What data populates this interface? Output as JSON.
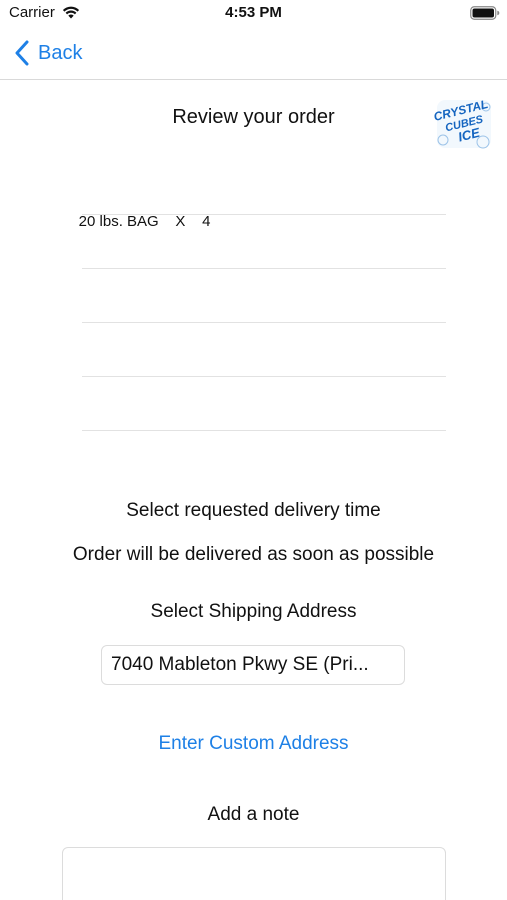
{
  "status_bar": {
    "carrier": "Carrier",
    "time": "4:53 PM",
    "wifi_icon": "wifi-icon",
    "battery_icon": "battery-full-icon"
  },
  "nav": {
    "back_label": "Back",
    "back_icon": "chevron-left-icon",
    "accent_color": "#1e80e6"
  },
  "header": {
    "title": "Review your order",
    "logo_text": [
      "CRYSTAL",
      "CUBES",
      "ICE"
    ]
  },
  "order": {
    "items": [
      {
        "product": "20 lbs. BAG",
        "separator": "X",
        "quantity": "4"
      }
    ]
  },
  "delivery": {
    "heading": "Select requested delivery time",
    "value": "Order will be delivered as soon as possible"
  },
  "shipping": {
    "heading": "Select Shipping Address",
    "selected_address": "7040 Mableton Pkwy SE (Pri...",
    "custom_address_link": "Enter Custom Address"
  },
  "note": {
    "heading": "Add a note",
    "value": ""
  }
}
